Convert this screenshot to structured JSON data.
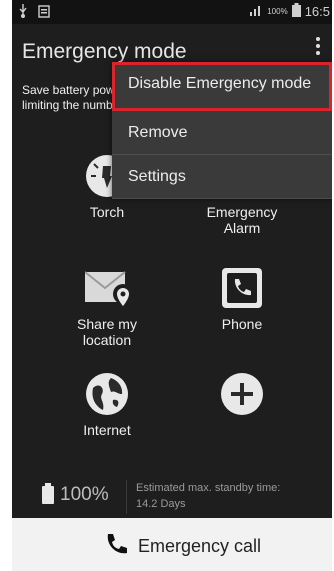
{
  "status_bar": {
    "left_icons": [
      "usb-icon",
      "clipboard-icon"
    ],
    "battery_text": "100%",
    "time": "16:5"
  },
  "header": {
    "title": "Emergency mode"
  },
  "description": "Save battery power by using a simple screen layout and limiting the number of usable apps.",
  "menu": {
    "items": [
      {
        "label": "Disable Emergency mode",
        "highlight_color": "#d8242a"
      },
      {
        "label": "Remove"
      },
      {
        "label": "Settings"
      }
    ]
  },
  "apps": [
    {
      "label": "Torch",
      "icon": "torch-icon"
    },
    {
      "label": "Emergency Alarm",
      "icon": "alarm-icon"
    },
    {
      "label": "Share my location",
      "icon": "location-icon"
    },
    {
      "label": "Phone",
      "icon": "phone-icon"
    },
    {
      "label": "Internet",
      "icon": "globe-icon"
    },
    {
      "label": "",
      "icon": "add-icon"
    }
  ],
  "battery": {
    "percent_text": "100%",
    "standby_label": "Estimated max. standby time:",
    "standby_value": "14.2 Days"
  },
  "call_bar": {
    "label": "Emergency call",
    "icon": "phone-handset-icon"
  }
}
